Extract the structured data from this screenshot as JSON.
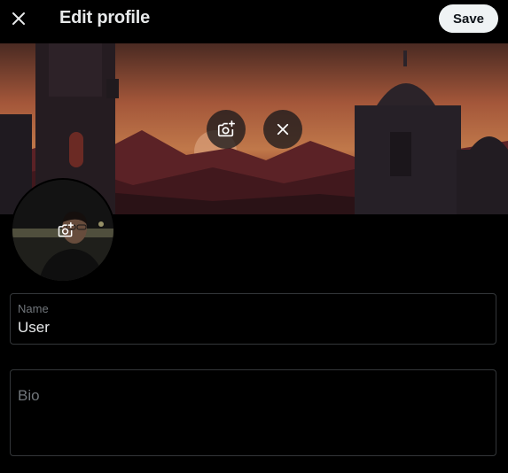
{
  "header": {
    "title": "Edit profile",
    "save_label": "Save",
    "close_icon": "close-icon"
  },
  "banner": {
    "add_photo_icon": "camera-add-icon",
    "remove_icon": "close-icon"
  },
  "avatar": {
    "add_photo_icon": "camera-add-icon"
  },
  "fields": {
    "name": {
      "label": "Name",
      "value": "User"
    },
    "bio": {
      "placeholder": "Bio",
      "value": ""
    }
  },
  "colors": {
    "background": "#000000",
    "text": "#e7e9ea",
    "muted": "#71767b",
    "border": "#333639",
    "save_bg": "#eff3f4"
  }
}
